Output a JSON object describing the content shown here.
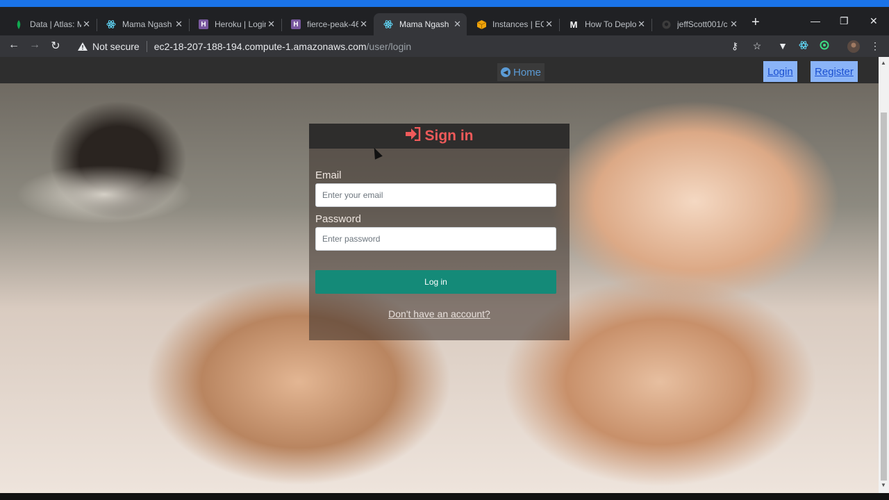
{
  "browser": {
    "tabs": [
      {
        "title": "Data | Atlas: M",
        "icon": "mongodb-leaf-icon"
      },
      {
        "title": "Mama Ngash",
        "icon": "react-icon"
      },
      {
        "title": "Heroku | Login",
        "icon": "heroku-icon"
      },
      {
        "title": "fierce-peak-46",
        "icon": "heroku-icon"
      },
      {
        "title": "Mama Ngash",
        "icon": "react-icon"
      },
      {
        "title": "Instances | EC2",
        "icon": "aws-cube-icon"
      },
      {
        "title": "How To Deplo",
        "icon": "medium-icon"
      },
      {
        "title": "jeffScott001/c",
        "icon": "github-icon"
      }
    ],
    "active_tab": 4,
    "security_text": "Not secure",
    "url_host": "ec2-18-207-188-194.compute-1.amazonaws.com",
    "url_path": "/user/login"
  },
  "nav": {
    "home_label": "Home",
    "login_label": "Login",
    "register_label": "Register"
  },
  "form": {
    "title": "Sign in",
    "email_label": "Email",
    "email_placeholder": "Enter your email",
    "password_label": "Password",
    "password_placeholder": "Enter password",
    "submit_label": "Log in",
    "account_link": "Don't have an account?"
  },
  "colors": {
    "accent": "#148a78",
    "title_red": "#f05a5a",
    "link_blue": "#5b9bd5"
  }
}
